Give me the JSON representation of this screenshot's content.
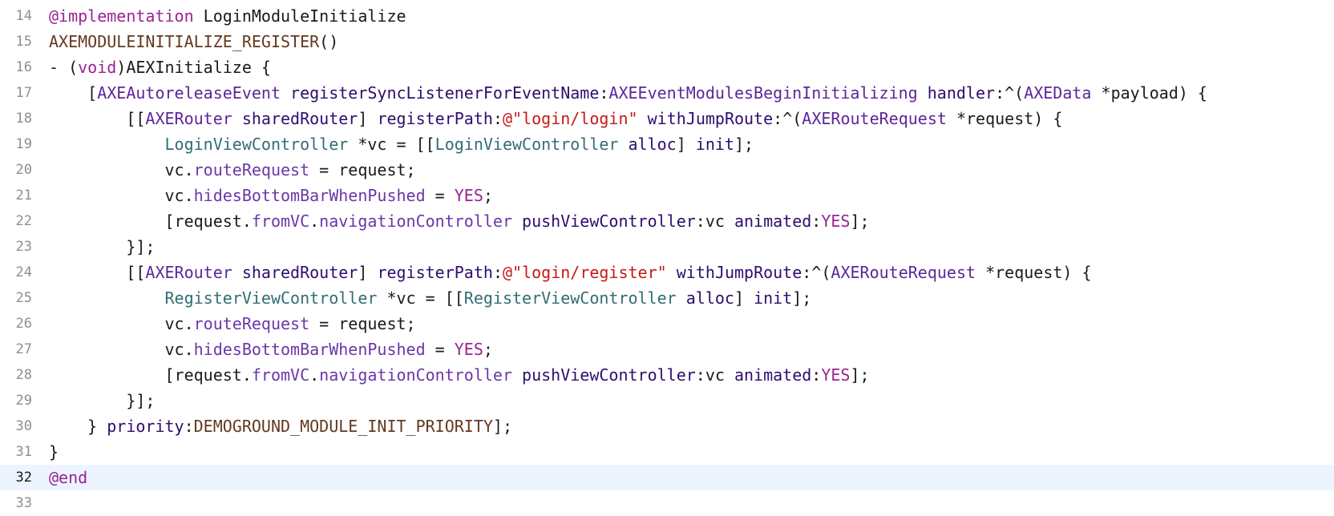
{
  "editor": {
    "language": "objective-c",
    "current_line": 32,
    "colors": {
      "keyword": "#9b2393",
      "macro": "#643820",
      "class": "#5c2699",
      "local_class": "#326d74",
      "property": "#6c36a9",
      "string": "#c41a16",
      "method": "#2e0d6e",
      "plain": "#1a1a1a",
      "line_number": "#8e8e93",
      "current_line_bg": "#ecf5ff"
    },
    "lines": [
      {
        "num": "14",
        "indent": "",
        "tokens": [
          {
            "t": "@implementation",
            "c": "kw"
          },
          {
            "t": " LoginModuleInitialize",
            "c": "plain"
          }
        ]
      },
      {
        "num": "15",
        "indent": "",
        "tokens": [
          {
            "t": "AXEMODULEINITIALIZE_REGISTER",
            "c": "macro"
          },
          {
            "t": "()",
            "c": "plain"
          }
        ]
      },
      {
        "num": "16",
        "indent": "",
        "tokens": [
          {
            "t": "- (",
            "c": "plain"
          },
          {
            "t": "void",
            "c": "kw"
          },
          {
            "t": ")AEXInitialize {",
            "c": "plain"
          }
        ]
      },
      {
        "num": "17",
        "indent": "    ",
        "tokens": [
          {
            "t": "[",
            "c": "plain"
          },
          {
            "t": "AXEAutoreleaseEvent",
            "c": "cls"
          },
          {
            "t": " ",
            "c": "plain"
          },
          {
            "t": "registerSyncListenerForEventName",
            "c": "meth"
          },
          {
            "t": ":",
            "c": "plain"
          },
          {
            "t": "AXEEventModulesBeginInitializing",
            "c": "cls"
          },
          {
            "t": " ",
            "c": "plain"
          },
          {
            "t": "handler",
            "c": "meth"
          },
          {
            "t": ":^(",
            "c": "plain"
          },
          {
            "t": "AXEData",
            "c": "cls"
          },
          {
            "t": " *payload) {",
            "c": "plain"
          }
        ]
      },
      {
        "num": "18",
        "indent": "        ",
        "tokens": [
          {
            "t": "[[",
            "c": "plain"
          },
          {
            "t": "AXERouter",
            "c": "cls"
          },
          {
            "t": " ",
            "c": "plain"
          },
          {
            "t": "sharedRouter",
            "c": "meth"
          },
          {
            "t": "] ",
            "c": "plain"
          },
          {
            "t": "registerPath",
            "c": "meth"
          },
          {
            "t": ":",
            "c": "plain"
          },
          {
            "t": "@\"login/login\"",
            "c": "str"
          },
          {
            "t": " ",
            "c": "plain"
          },
          {
            "t": "withJumpRoute",
            "c": "meth"
          },
          {
            "t": ":^(",
            "c": "plain"
          },
          {
            "t": "AXERouteRequest",
            "c": "cls"
          },
          {
            "t": " *request) {",
            "c": "plain"
          }
        ]
      },
      {
        "num": "19",
        "indent": "            ",
        "tokens": [
          {
            "t": "LoginViewController",
            "c": "sel"
          },
          {
            "t": " *vc = [[",
            "c": "plain"
          },
          {
            "t": "LoginViewController",
            "c": "sel"
          },
          {
            "t": " ",
            "c": "plain"
          },
          {
            "t": "alloc",
            "c": "meth"
          },
          {
            "t": "] ",
            "c": "plain"
          },
          {
            "t": "init",
            "c": "meth"
          },
          {
            "t": "];",
            "c": "plain"
          }
        ]
      },
      {
        "num": "20",
        "indent": "            ",
        "tokens": [
          {
            "t": "vc.",
            "c": "plain"
          },
          {
            "t": "routeRequest",
            "c": "prop"
          },
          {
            "t": " = request;",
            "c": "plain"
          }
        ]
      },
      {
        "num": "21",
        "indent": "            ",
        "tokens": [
          {
            "t": "vc.",
            "c": "plain"
          },
          {
            "t": "hidesBottomBarWhenPushed",
            "c": "prop"
          },
          {
            "t": " = ",
            "c": "plain"
          },
          {
            "t": "YES",
            "c": "kw"
          },
          {
            "t": ";",
            "c": "plain"
          }
        ]
      },
      {
        "num": "22",
        "indent": "            ",
        "tokens": [
          {
            "t": "[request.",
            "c": "plain"
          },
          {
            "t": "fromVC",
            "c": "prop"
          },
          {
            "t": ".",
            "c": "plain"
          },
          {
            "t": "navigationController",
            "c": "prop"
          },
          {
            "t": " ",
            "c": "plain"
          },
          {
            "t": "pushViewController",
            "c": "meth"
          },
          {
            "t": ":vc ",
            "c": "plain"
          },
          {
            "t": "animated",
            "c": "meth"
          },
          {
            "t": ":",
            "c": "plain"
          },
          {
            "t": "YES",
            "c": "kw"
          },
          {
            "t": "];",
            "c": "plain"
          }
        ]
      },
      {
        "num": "23",
        "indent": "        ",
        "tokens": [
          {
            "t": "}];",
            "c": "plain"
          }
        ]
      },
      {
        "num": "24",
        "indent": "        ",
        "tokens": [
          {
            "t": "[[",
            "c": "plain"
          },
          {
            "t": "AXERouter",
            "c": "cls"
          },
          {
            "t": " ",
            "c": "plain"
          },
          {
            "t": "sharedRouter",
            "c": "meth"
          },
          {
            "t": "] ",
            "c": "plain"
          },
          {
            "t": "registerPath",
            "c": "meth"
          },
          {
            "t": ":",
            "c": "plain"
          },
          {
            "t": "@\"login/register\"",
            "c": "str"
          },
          {
            "t": " ",
            "c": "plain"
          },
          {
            "t": "withJumpRoute",
            "c": "meth"
          },
          {
            "t": ":^(",
            "c": "plain"
          },
          {
            "t": "AXERouteRequest",
            "c": "cls"
          },
          {
            "t": " *request) {",
            "c": "plain"
          }
        ]
      },
      {
        "num": "25",
        "indent": "            ",
        "tokens": [
          {
            "t": "RegisterViewController",
            "c": "sel"
          },
          {
            "t": " *vc = [[",
            "c": "plain"
          },
          {
            "t": "RegisterViewController",
            "c": "sel"
          },
          {
            "t": " ",
            "c": "plain"
          },
          {
            "t": "alloc",
            "c": "meth"
          },
          {
            "t": "] ",
            "c": "plain"
          },
          {
            "t": "init",
            "c": "meth"
          },
          {
            "t": "];",
            "c": "plain"
          }
        ]
      },
      {
        "num": "26",
        "indent": "            ",
        "tokens": [
          {
            "t": "vc.",
            "c": "plain"
          },
          {
            "t": "routeRequest",
            "c": "prop"
          },
          {
            "t": " = request;",
            "c": "plain"
          }
        ]
      },
      {
        "num": "27",
        "indent": "            ",
        "tokens": [
          {
            "t": "vc.",
            "c": "plain"
          },
          {
            "t": "hidesBottomBarWhenPushed",
            "c": "prop"
          },
          {
            "t": " = ",
            "c": "plain"
          },
          {
            "t": "YES",
            "c": "kw"
          },
          {
            "t": ";",
            "c": "plain"
          }
        ]
      },
      {
        "num": "28",
        "indent": "            ",
        "tokens": [
          {
            "t": "[request.",
            "c": "plain"
          },
          {
            "t": "fromVC",
            "c": "prop"
          },
          {
            "t": ".",
            "c": "plain"
          },
          {
            "t": "navigationController",
            "c": "prop"
          },
          {
            "t": " ",
            "c": "plain"
          },
          {
            "t": "pushViewController",
            "c": "meth"
          },
          {
            "t": ":vc ",
            "c": "plain"
          },
          {
            "t": "animated",
            "c": "meth"
          },
          {
            "t": ":",
            "c": "plain"
          },
          {
            "t": "YES",
            "c": "kw"
          },
          {
            "t": "];",
            "c": "plain"
          }
        ]
      },
      {
        "num": "29",
        "indent": "        ",
        "tokens": [
          {
            "t": "}];",
            "c": "plain"
          }
        ]
      },
      {
        "num": "30",
        "indent": "    ",
        "tokens": [
          {
            "t": "} ",
            "c": "plain"
          },
          {
            "t": "priority",
            "c": "meth"
          },
          {
            "t": ":",
            "c": "plain"
          },
          {
            "t": "DEMOGROUND_MODULE_INIT_PRIORITY",
            "c": "macro"
          },
          {
            "t": "];",
            "c": "plain"
          }
        ]
      },
      {
        "num": "31",
        "indent": "",
        "tokens": [
          {
            "t": "}",
            "c": "plain"
          }
        ]
      },
      {
        "num": "32",
        "indent": "",
        "tokens": [
          {
            "t": "@end",
            "c": "kw"
          }
        ]
      },
      {
        "num": "33",
        "indent": "",
        "tokens": []
      }
    ]
  }
}
